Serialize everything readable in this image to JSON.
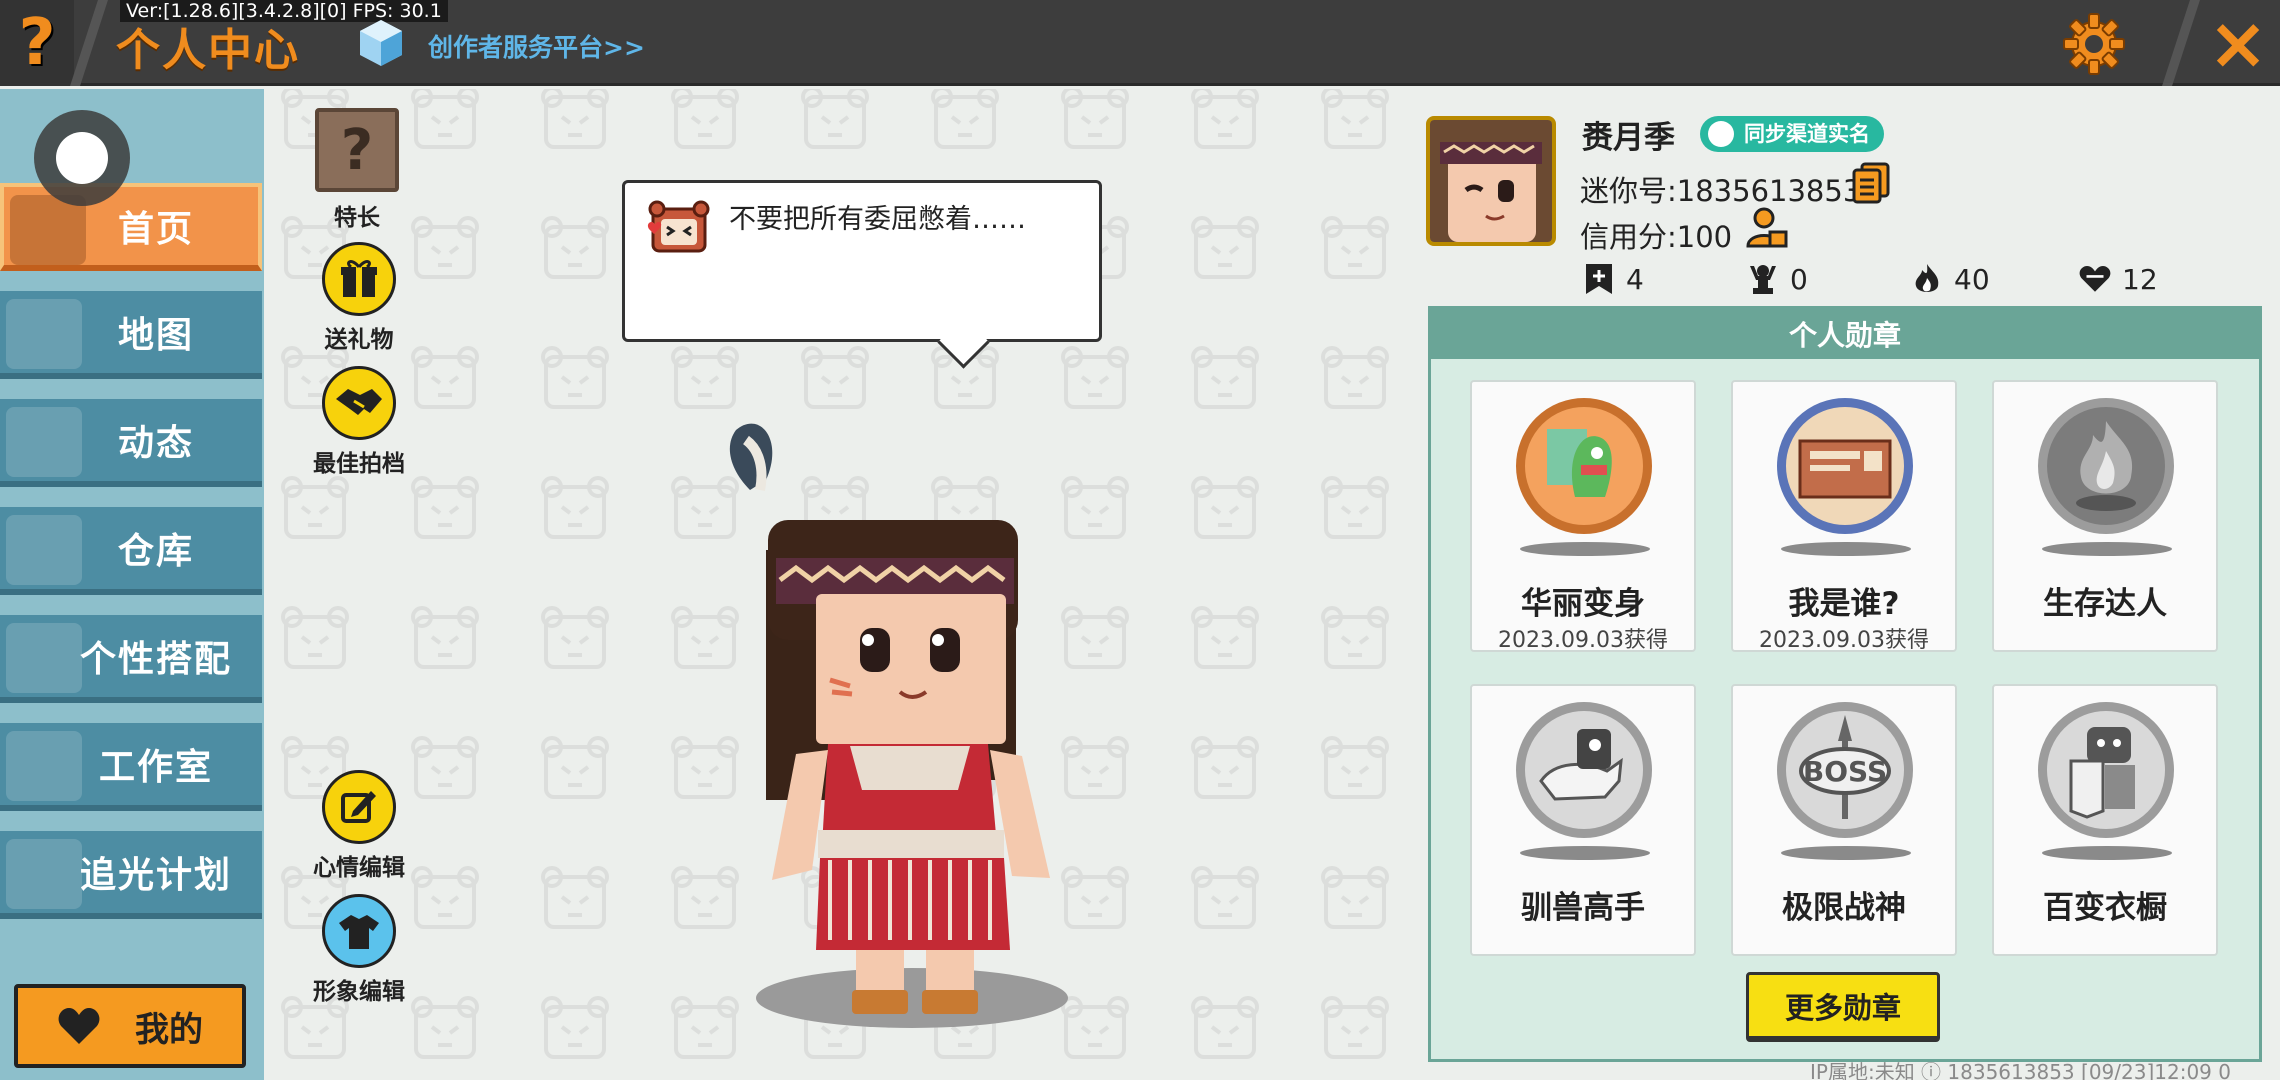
{
  "topbar": {
    "help_icon": "?",
    "version": "Ver:[1.28.6][3.4.2.8][0] FPS: 30.1",
    "title": "个人中心",
    "creator_link": "创作者服务平台>>",
    "gear_icon": "gear-icon",
    "close_icon": "×"
  },
  "sidebar": {
    "items": [
      {
        "label": "首页",
        "active": true
      },
      {
        "label": "地图",
        "active": false
      },
      {
        "label": "动态",
        "active": false
      },
      {
        "label": "仓库",
        "active": false
      },
      {
        "label": "个性搭配",
        "active": false
      },
      {
        "label": "工作室",
        "active": false
      },
      {
        "label": "追光计划",
        "active": false
      }
    ],
    "mine_label": "我的"
  },
  "actions": {
    "specialty": "特长",
    "gift": "送礼物",
    "partner": "最佳拍档",
    "mood_edit": "心情编辑",
    "image_edit": "形象编辑"
  },
  "bubble": {
    "text": "不要把所有委屈憋着……"
  },
  "profile": {
    "username": "赉月季",
    "verify_badge": "同步渠道实名",
    "mini_id": "迷你号:1835613853",
    "credit": "信用分:100",
    "stats": [
      {
        "icon": "bookmark-plus-icon",
        "value": "4"
      },
      {
        "icon": "trophy-person-icon",
        "value": "0"
      },
      {
        "icon": "flame-icon",
        "value": "40"
      },
      {
        "icon": "heart-icon",
        "value": "12"
      }
    ]
  },
  "medals": {
    "header": "个人勋章",
    "items": [
      {
        "name": "华丽变身",
        "date": "2023.09.03获得",
        "earned": true
      },
      {
        "name": "我是谁?",
        "date": "2023.09.03获得",
        "earned": true
      },
      {
        "name": "生存达人",
        "date": "",
        "earned": false
      },
      {
        "name": "驯兽高手",
        "date": "",
        "earned": false
      },
      {
        "name": "极限战神",
        "date": "",
        "earned": false
      },
      {
        "name": "百变衣橱",
        "date": "",
        "earned": false
      }
    ],
    "more_label": "更多勋章"
  },
  "footer": {
    "text": "IP属地:未知 ⓘ   1835613853   [09/23]12:09 0"
  },
  "colors": {
    "accent_orange": "#f08c1e",
    "sidebar_blue": "#4d8da3",
    "panel_green": "#6aa597",
    "button_yellow": "#f7df12"
  }
}
